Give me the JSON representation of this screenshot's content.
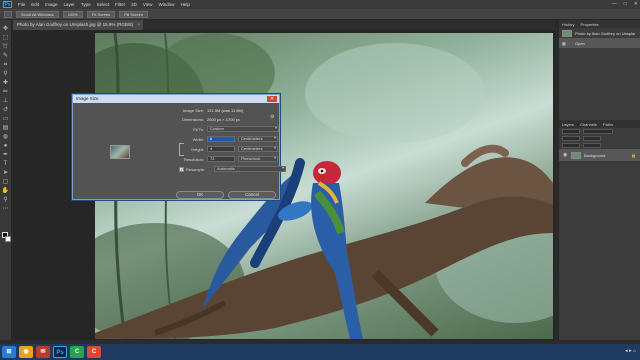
{
  "menubar": {
    "logo": "Ps",
    "items": [
      "File",
      "Edit",
      "Image",
      "Layer",
      "Type",
      "Select",
      "Filter",
      "3D",
      "View",
      "Window",
      "Help"
    ],
    "min": "—",
    "max": "□",
    "close": "✕"
  },
  "optbar": {
    "buttons": [
      "Scroll All Windows",
      "100%",
      "Fit Screen",
      "Fill Screen"
    ]
  },
  "document": {
    "tab_title": "Photo by Alan Godfrey on Unsplash.jpg @ 15.9% (RGB/8)",
    "tab_close": "×"
  },
  "right_panel": {
    "history_tabs": [
      "History",
      "Properties"
    ],
    "history_items": [
      "Photo by Alan Godfrey on Unsplash.jpg",
      "Open"
    ],
    "layers_tabs": [
      "Layers",
      "Channels",
      "Paths"
    ],
    "layer_name": "Background"
  },
  "dialog": {
    "title": "Image Size",
    "close": "✕",
    "image_size_label": "Image Size:",
    "image_size_value": "121.5M (was 11.9M)",
    "dimensions_label": "Dimensions:",
    "dimensions_value": "2500 px × 1700 px",
    "fit_to_label": "Fit To:",
    "fit_to_value": "Custom",
    "width_label": "Width:",
    "width_value": "6",
    "width_unit": "Centimeters",
    "height_label": "Height:",
    "height_value": "4",
    "height_unit": "Centimeters",
    "resolution_label": "Resolution:",
    "resolution_value": "72",
    "resolution_unit": "Pixels/Inch",
    "resample_label": "Resample:",
    "resample_checked": "✓",
    "resample_value": "Automatic",
    "ok_label": "OK",
    "cancel_label": "Cancel",
    "gear_icon": "⚙"
  },
  "taskbar": {
    "icons": [
      {
        "name": "windows-start-icon",
        "glyph": "⊞",
        "color": "#2b79d6"
      },
      {
        "name": "chrome-icon",
        "glyph": "◉",
        "color": "#e8a317"
      },
      {
        "name": "app-icon-red",
        "glyph": "✉",
        "color": "#c0392b"
      },
      {
        "name": "photoshop-icon",
        "glyph": "Ps",
        "color": "#0b2440"
      },
      {
        "name": "app-icon-green",
        "glyph": "C",
        "color": "#2aa34a"
      },
      {
        "name": "app-icon-c-red",
        "glyph": "C",
        "color": "#d84a35"
      }
    ],
    "tray": "◂ ▸ ⌂"
  },
  "colors": {
    "accent": "#31a8ff",
    "dialog_border": "#7a9fd1",
    "selection": "#1f5bb3"
  }
}
